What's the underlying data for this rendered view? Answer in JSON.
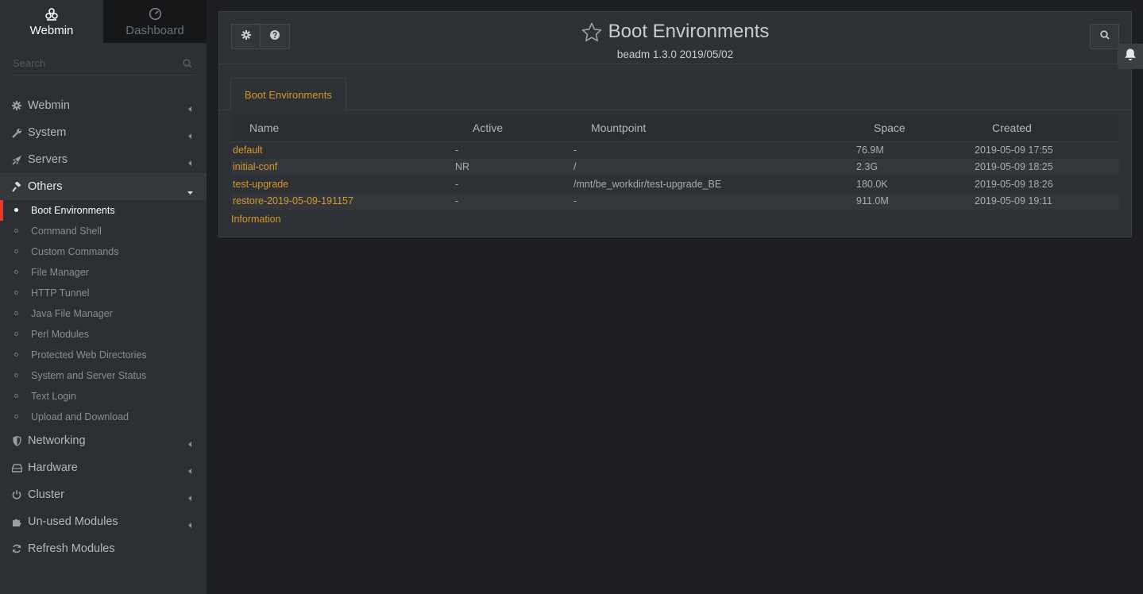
{
  "sidebar": {
    "tabs": [
      {
        "label": "Webmin",
        "icon": "webmin-logo-icon",
        "active": true
      },
      {
        "label": "Dashboard",
        "icon": "dashboard-gauge-icon",
        "active": false
      }
    ],
    "search_placeholder": "Search",
    "categories": [
      {
        "label": "Webmin",
        "icon": "gear-icon"
      },
      {
        "label": "System",
        "icon": "wrench-icon"
      },
      {
        "label": "Servers",
        "icon": "rocket-icon"
      },
      {
        "label": "Others",
        "icon": "gavel-icon",
        "open": true
      },
      {
        "label": "Networking",
        "icon": "shield-icon"
      },
      {
        "label": "Hardware",
        "icon": "hard-drive-icon"
      },
      {
        "label": "Cluster",
        "icon": "power-icon"
      },
      {
        "label": "Un-used Modules",
        "icon": "puzzle-icon"
      },
      {
        "label": "Refresh Modules",
        "icon": "refresh-icon"
      }
    ],
    "others_items": [
      {
        "label": "Boot Environments",
        "active": true
      },
      {
        "label": "Command Shell"
      },
      {
        "label": "Custom Commands"
      },
      {
        "label": "File Manager"
      },
      {
        "label": "HTTP Tunnel"
      },
      {
        "label": "Java File Manager"
      },
      {
        "label": "Perl Modules"
      },
      {
        "label": "Protected Web Directories"
      },
      {
        "label": "System and Server Status"
      },
      {
        "label": "Text Login"
      },
      {
        "label": "Upload and Download"
      }
    ]
  },
  "header": {
    "title": "Boot Environments",
    "subtitle": "beadm 1.3.0 2019/05/02"
  },
  "tabs": [
    "Boot Environments"
  ],
  "table": {
    "columns": [
      "Name",
      "Active",
      "Mountpoint",
      "Space",
      "Created"
    ],
    "rows": [
      [
        "default",
        "-",
        "-",
        "76.9M",
        "2019-05-09 17:55"
      ],
      [
        "initial-conf",
        "NR",
        "/",
        "2.3G",
        "2019-05-09 18:25"
      ],
      [
        "test-upgrade",
        "-",
        "/mnt/be_workdir/test-upgrade_BE",
        "180.0K",
        "2019-05-09 18:26"
      ],
      [
        "restore-2019-05-09-191157",
        "-",
        "-",
        "911.0M",
        "2019-05-09 19:11"
      ]
    ]
  },
  "footer_link": "Information",
  "colors": {
    "accent": "#d59a2c",
    "active_marker": "#e23a2f",
    "sidebar_bg": "#2c2f33",
    "page_bg": "#1d1f22"
  }
}
